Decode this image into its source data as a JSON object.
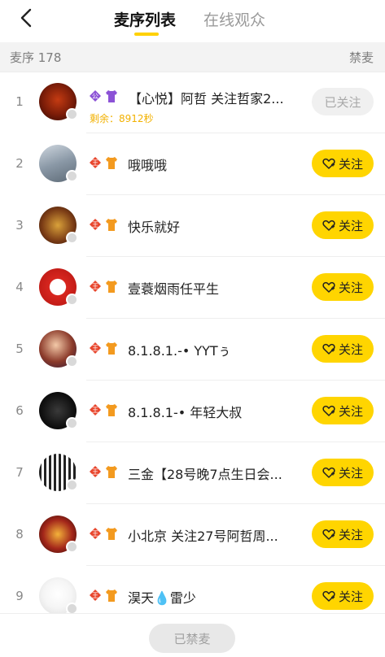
{
  "header": {
    "tabs": [
      {
        "label": "麦序列表",
        "active": true
      },
      {
        "label": "在线观众",
        "active": false
      }
    ]
  },
  "subbar": {
    "count_label": "麦序 178",
    "ban_label": "禁麦"
  },
  "rows": [
    {
      "index": "1",
      "name": "【心悦】阿哲 关注哲家2...",
      "timer": "剩余：8912秒",
      "button": "已关注",
      "followed": true,
      "badges": [
        "official-badge-icon",
        "shirt-purple-icon"
      ]
    },
    {
      "index": "2",
      "name": "哦哦哦",
      "button": "关注",
      "badges": [
        "king-badge-icon",
        "shirt-orange-icon"
      ]
    },
    {
      "index": "3",
      "name": "快乐就好",
      "button": "关注",
      "badges": [
        "king-badge-icon",
        "shirt-orange-icon"
      ]
    },
    {
      "index": "4",
      "name": "壹蓑烟雨任平生",
      "button": "关注",
      "badges": [
        "king-badge-icon",
        "shirt-orange-icon"
      ]
    },
    {
      "index": "5",
      "name": "8.1.8.1.-• YYTぅ",
      "button": "关注",
      "badges": [
        "king-badge-icon",
        "shirt-orange-icon"
      ]
    },
    {
      "index": "6",
      "name": "8.1.8.1-• 年轻大叔",
      "button": "关注",
      "badges": [
        "king-badge-icon",
        "shirt-orange-icon"
      ]
    },
    {
      "index": "7",
      "name": "三金【28号晚7点生日会...",
      "button": "关注",
      "badges": [
        "king-badge-icon",
        "shirt-orange-icon"
      ]
    },
    {
      "index": "8",
      "name": "小北京 关注27号阿哲周...",
      "button": "关注",
      "badges": [
        "king-badge-icon",
        "shirt-orange-icon"
      ]
    },
    {
      "index": "9",
      "name": "淏天💧雷少",
      "button": "关注",
      "badges": [
        "king-badge-icon",
        "shirt-orange-icon"
      ]
    }
  ],
  "footer": {
    "banned_label": "已禁麦"
  },
  "colors": {
    "accent": "#ffd500",
    "timer": "#f2b100",
    "badge_red": "#e8452c",
    "badge_orange": "#f39a1f",
    "badge_purple": "#8c52d6"
  }
}
